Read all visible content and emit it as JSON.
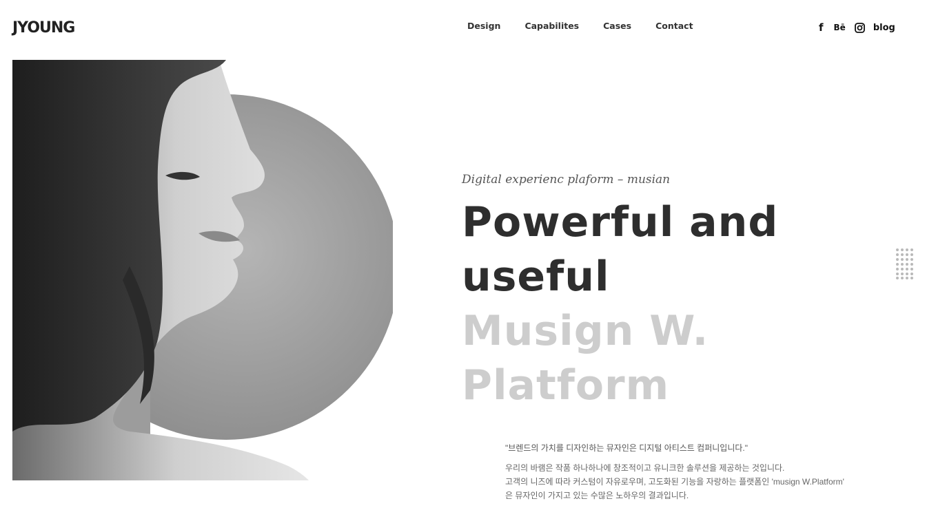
{
  "brand": {
    "logo": "JYOUNG"
  },
  "nav": [
    "Design",
    "Capabilites",
    "Cases",
    "Contact"
  ],
  "social": {
    "facebook": "f",
    "behance": "Bē",
    "instagram_icon": "instagram-icon",
    "blog": "blog"
  },
  "hero": {
    "subtitle": "Digital experienc plaform – musian",
    "headline_dark": [
      "Powerful and",
      "useful"
    ],
    "headline_light": [
      "Musign W.",
      "Platform"
    ],
    "quote": "\"브렌드의 가치를 디자인하는 뮤자인은 디지털 아티스트 컴퍼니입니다.\"",
    "description": [
      "우리의 바램은 작품 하나하나에 창조적이고 유니크한 솔루션을 제공하는 것입니다.",
      "고객의 니즈에 따라 커스텀이 자유로우며, 고도화된 기능을 자랑하는 플랫폼인 'musign W.Platform'",
      "은 뮤자인이 가지고 있는 수많은 노하우의 결과입니다."
    ]
  },
  "colors": {
    "headline_dark": "#2e2e2e",
    "headline_light": "#cdcdcd",
    "circle": "#9a9a9a"
  }
}
